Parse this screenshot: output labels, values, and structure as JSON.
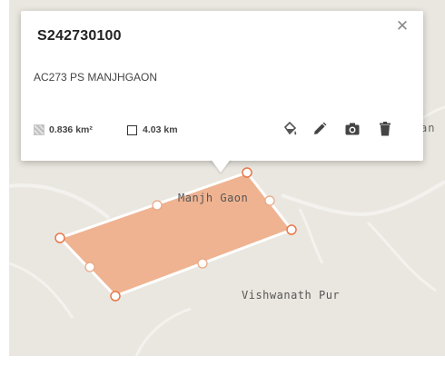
{
  "popup": {
    "title": "S242730100",
    "subtitle": "AC273 PS MANJHGAON",
    "area": "0.836 km²",
    "perimeter": "4.03 km"
  },
  "icons": {
    "close": "close-icon",
    "area": "area-icon",
    "perimeter": "perimeter-icon",
    "fill": "paint-bucket-icon",
    "edit": "pencil-icon",
    "camera": "camera-icon",
    "delete": "trash-icon"
  },
  "map": {
    "places": [
      "Manjh Gaon",
      "Vishwanath Pur"
    ],
    "partial_label": "an"
  },
  "colors": {
    "polygon_fill": "#efad88",
    "polygon_stroke": "#ffffff",
    "vertex_stroke": "#e8784b",
    "map_background": "#eae7e0"
  }
}
